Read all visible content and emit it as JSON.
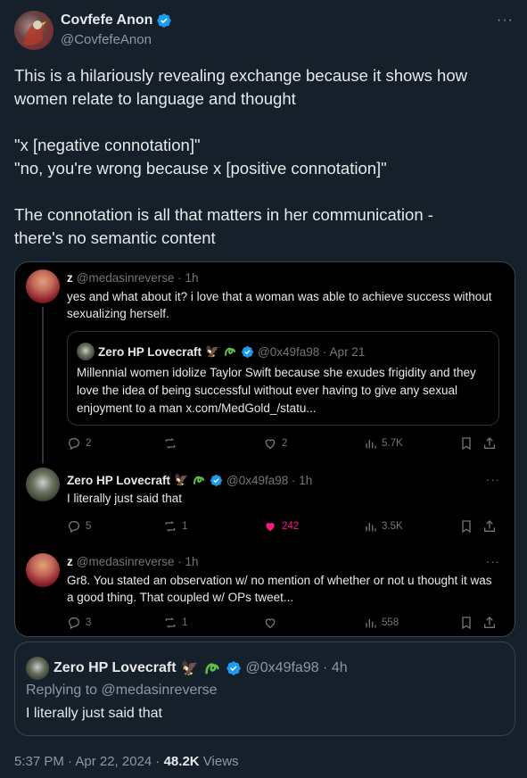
{
  "author": {
    "name": "Covfefe Anon",
    "handle": "@CovfefeAnon"
  },
  "more_label": "···",
  "tweet": {
    "lines": [
      "This is a hilariously revealing exchange because it shows how",
      "women relate to language and thought",
      "",
      "\"x [negative connotation]\"",
      "\"no, you're wrong because x [positive connotation]\"",
      "",
      "The connotation is all that matters in her communication -",
      "there's no semantic content"
    ]
  },
  "embedded": {
    "reply1": {
      "name": "z",
      "meta": "@medasinreverse · 1h",
      "text": "yes and what about it? i love that a woman was able to achieve success without sexualizing herself.",
      "quote": {
        "name": "Zero HP Lovecraft",
        "meta": "@0x49fa98 · Apr 21",
        "text": "Millennial women idolize Taylor Swift because she exudes frigidity and they love the idea of being successful without ever having to give any sexual enjoyment to a man x.com/MedGold_/statu..."
      },
      "actions": {
        "replies": "2",
        "reposts": "",
        "likes": "2",
        "views": "5.7K"
      }
    },
    "reply2": {
      "name": "Zero HP Lovecraft",
      "meta": "@0x49fa98 · 1h",
      "text": "I literally just said that",
      "actions": {
        "replies": "5",
        "reposts": "1",
        "likes": "242",
        "views": "3.5K"
      }
    },
    "reply3": {
      "name": "z",
      "meta": "@medasinreverse · 1h",
      "text": "Gr8. You stated an observation w/ no mention of whether or not u thought it was a good thing. That coupled w/ OPs tweet...",
      "actions": {
        "replies": "3",
        "reposts": "1",
        "likes": "",
        "views": "558"
      }
    }
  },
  "quote_tweet": {
    "name": "Zero HP Lovecraft",
    "meta": "@0x49fa98 · 4h",
    "replying": "Replying to @medasinreverse",
    "text": "I literally just said that"
  },
  "footer": {
    "timestamp": "5:37 PM · Apr 22, 2024 · ",
    "views_count": "48.2K",
    "views_label": " Views"
  },
  "colors": {
    "background": "#15202b",
    "verified": "#1d9bf0",
    "like": "#f91880",
    "secondary_text": "#8b98a5"
  }
}
